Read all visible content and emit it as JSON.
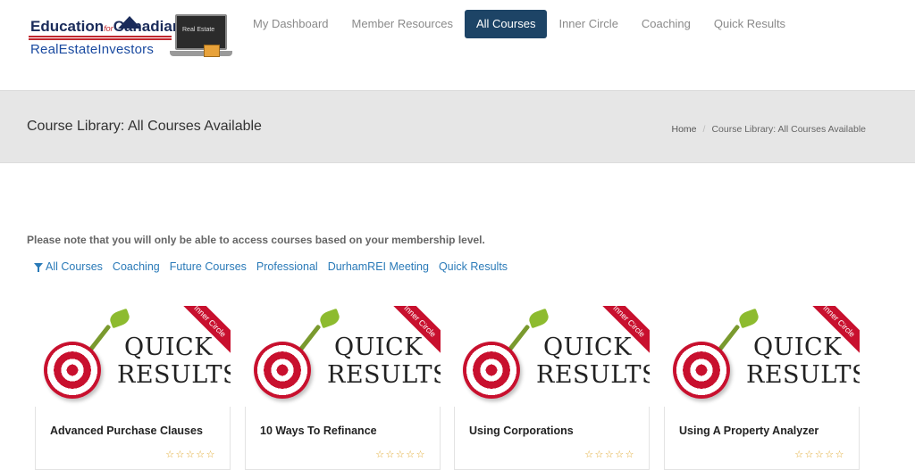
{
  "logo": {
    "line1": "Education",
    "for_word": "for",
    "line1b": "Canadian",
    "line2": "RealEstateInvestors",
    "laptop_text": "Real Estate"
  },
  "nav": {
    "items": [
      {
        "label": "My Dashboard",
        "active": false
      },
      {
        "label": "Member Resources",
        "active": false
      },
      {
        "label": "All Courses",
        "active": true
      },
      {
        "label": "Inner Circle",
        "active": false
      },
      {
        "label": "Coaching",
        "active": false
      },
      {
        "label": "Quick Results",
        "active": false
      }
    ]
  },
  "page": {
    "title": "Course Library: All Courses Available"
  },
  "breadcrumb": {
    "home": "Home",
    "separator": "/",
    "current": "Course Library: All Courses Available"
  },
  "notice": "Please note that you will only be able to access courses based on your membership level.",
  "filters": [
    {
      "label": "All Courses",
      "icon": "filter-icon"
    },
    {
      "label": "Coaching"
    },
    {
      "label": "Future Courses"
    },
    {
      "label": "Professional"
    },
    {
      "label": "DurhamREI Meeting"
    },
    {
      "label": "Quick Results"
    }
  ],
  "cards": [
    {
      "title": "Advanced Purchase Clauses",
      "image_top": "QUICK",
      "image_bottom": "RESULTS",
      "ribbon": "Inner Circle",
      "rating": 0,
      "rating_max": 5
    },
    {
      "title": "10 Ways To Refinance",
      "image_top": "QUICK",
      "image_bottom": "RESULTS",
      "ribbon": "Inner Circle",
      "rating": 0,
      "rating_max": 5
    },
    {
      "title": "Using Corporations",
      "image_top": "QUICK",
      "image_bottom": "RESULTS",
      "ribbon": "Inner Circle",
      "rating": 0,
      "rating_max": 5
    },
    {
      "title": "Using A Property Analyzer",
      "image_top": "QUICK",
      "image_bottom": "RESULTS",
      "ribbon": "Inner Circle",
      "rating": 0,
      "rating_max": 5
    }
  ],
  "stars_glyph": "☆☆☆☆☆",
  "colors": {
    "nav_active_bg": "#1d4466",
    "link": "#2a7ab8",
    "ribbon": "#c8102e",
    "stars": "#e0a82e"
  }
}
